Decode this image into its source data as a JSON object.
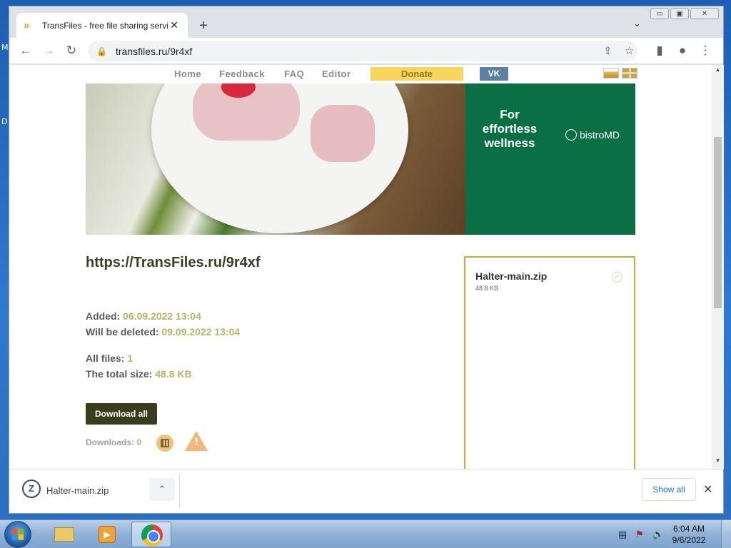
{
  "desktop": {
    "label_top": "M",
    "label_mid": "D"
  },
  "browser": {
    "tab_title": "TransFiles - free file sharing servi",
    "tab_close": "✕",
    "new_tab": "+",
    "tab_list": "⌄",
    "url": "transfiles.ru/9r4xf",
    "win_min": "▭",
    "win_max": "▣",
    "win_close": "✕"
  },
  "nav": {
    "home": "Home",
    "feedback": "Feedback",
    "faq": "FAQ",
    "editor": "Editor",
    "donate": "Donate",
    "vk": "VK"
  },
  "ad": {
    "headline": "For\neffortless\nwellness",
    "brand": "bistroMD"
  },
  "file_page": {
    "link": "https://TransFiles.ru/9r4xf",
    "added_label": "Added:",
    "added_value": "06.09.2022 13:04",
    "deleted_label": "Will be deleted:",
    "deleted_value": "09.09.2022 13:04",
    "all_files_label": "All files:",
    "all_files_value": "1",
    "total_size_label": "The total size:",
    "total_size_value": "48.8 KB",
    "download_all": "Download all",
    "downloads_label": "Downloads:",
    "downloads_value": "0",
    "warn_glyph": "!"
  },
  "file_list": [
    {
      "name": "Halter-main.zip",
      "size": "48.8 KB",
      "check": "✓"
    }
  ],
  "download_shelf": {
    "file_name": "Halter-main.zip",
    "show_all": "Show all",
    "close": "✕",
    "chevron": "⌃"
  },
  "taskbar": {
    "time": "6:04 AM",
    "date": "9/6/2022"
  },
  "colors": {
    "accent_yellow": "#f9d65b",
    "file_box_border": "#e0a436",
    "ad_green": "#0a7043",
    "download_button": "#3b3b1e"
  }
}
